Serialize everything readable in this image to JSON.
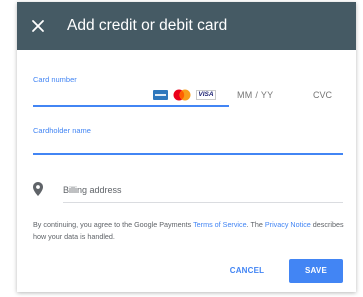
{
  "dialog": {
    "title": "Add credit or debit card",
    "close_icon": "close-icon"
  },
  "card_number": {
    "label": "Card number",
    "value": "",
    "logos": [
      "amex-logo",
      "mastercard-logo",
      "visa-logo"
    ],
    "visa_text": "VISA"
  },
  "expiry": {
    "placeholder": "MM  / YY"
  },
  "cvc": {
    "placeholder": "CVC"
  },
  "cardholder": {
    "label": "Cardholder name",
    "value": ""
  },
  "billing": {
    "icon": "location-pin-icon",
    "placeholder": "Billing address"
  },
  "disclaimer": {
    "part1": "By continuing, you agree to the Google Payments ",
    "terms_link": "Terms of Service",
    "part2": ". The ",
    "privacy_link": "Privacy Notice",
    "part3": " describes how your data is handled."
  },
  "actions": {
    "cancel": "CANCEL",
    "save": "SAVE"
  },
  "colors": {
    "header_bg": "#455a64",
    "accent": "#4285f4"
  }
}
